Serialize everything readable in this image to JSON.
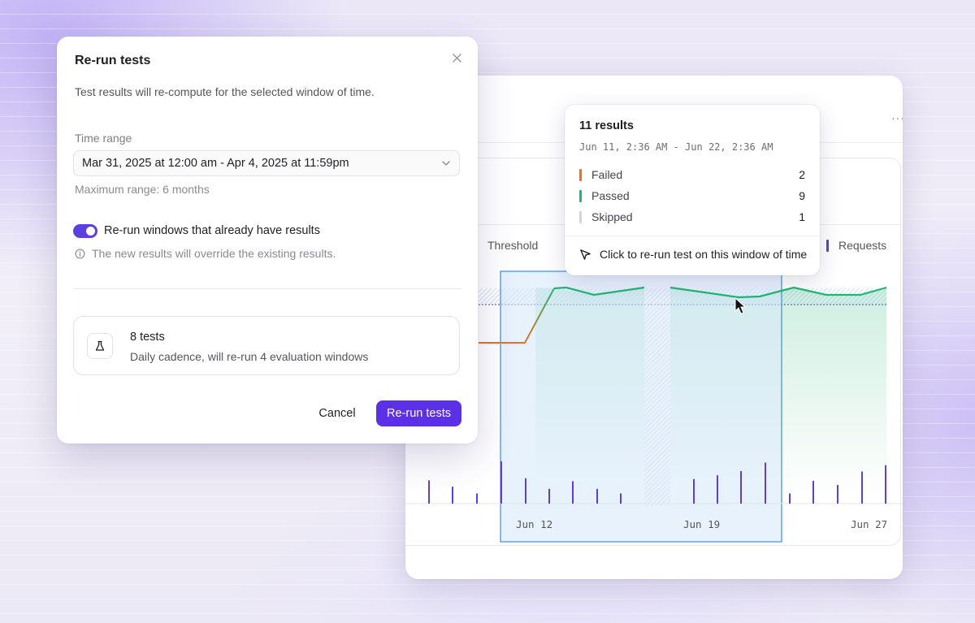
{
  "modal": {
    "title": "Re-run tests",
    "description": "Test results will re-compute for the selected window of time.",
    "time_range_label": "Time range",
    "time_range_value": "Mar 31, 2025 at 12:00 am - Apr 4, 2025 at 11:59pm",
    "max_range_hint": "Maximum range: 6 months",
    "toggle_label": "Re-run windows that already have results",
    "toggle_on": true,
    "override_note": "The new results will override the existing results.",
    "summary_title": "8 tests",
    "summary_subtitle": "Daily cadence, will re-run 4 evaluation windows",
    "cancel_label": "Cancel",
    "submit_label": "Re-run tests",
    "accent_color": "#5b30e6"
  },
  "panel": {
    "more_label": "···",
    "legend_threshold": "Threshold",
    "legend_requests": "Requests"
  },
  "tooltip": {
    "title": "11 results",
    "range": "Jun 11, 2:36 AM - Jun 22, 2:36 AM",
    "rows": [
      {
        "label": "Failed",
        "count": "2",
        "color": "#f06b2c"
      },
      {
        "label": "Passed",
        "count": "9",
        "color": "#22b573"
      },
      {
        "label": "Skipped",
        "count": "1",
        "color": "#d4d4da"
      }
    ],
    "action": "Click to re-run test on this window of time"
  },
  "chart_data": {
    "type": "bar",
    "x_ticks": [
      "Jun 12",
      "Jun 19",
      "Jun 27"
    ],
    "requests": [
      0.55,
      0.4,
      0.24,
      1.0,
      0.6,
      0.35,
      0.53,
      0.35,
      0.24,
      0.58,
      0.67,
      0.77,
      0.97,
      0.24,
      0.54,
      0.44,
      0.76,
      0.91
    ],
    "requests_color": "#5b3fd6",
    "failed_color": "#f06b2c",
    "passed_color": "#22b573",
    "selection": {
      "from": "Jun 11",
      "to": "Jun 22"
    }
  }
}
